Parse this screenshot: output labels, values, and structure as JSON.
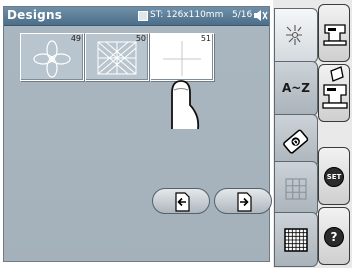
{
  "header": {
    "title": "Designs",
    "stitch_area": "ST: 126x110mm",
    "page_indicator": "5/16"
  },
  "thumbnails": [
    {
      "number": "49",
      "design": "four-petal flower outline"
    },
    {
      "number": "50",
      "design": "diagonal lattice square"
    },
    {
      "number": "51",
      "design": "cross grid",
      "selected": true
    }
  ],
  "navigation": {
    "prev_icon": "page-back-arrow-icon",
    "next_icon": "page-forward-arrow-icon"
  },
  "category_tabs": [
    {
      "name": "tab-builtin-designs",
      "icon": "sparkle-design-icon",
      "label": ""
    },
    {
      "name": "tab-alphabet",
      "icon": "",
      "label": "A~Z"
    },
    {
      "name": "tab-editing",
      "icon": "edit-pen-icon",
      "label": ""
    },
    {
      "name": "tab-grid",
      "icon": "grid-outline-icon",
      "label": ""
    },
    {
      "name": "tab-grid-fine",
      "icon": "fine-grid-icon",
      "label": ""
    }
  ],
  "side_buttons": [
    {
      "name": "sewing-mode-button",
      "icon": "sewing-machine-icon",
      "label": ""
    },
    {
      "name": "embroidery-mode-button",
      "icon": "embroidery-machine-icon",
      "label": ""
    },
    {
      "name": "settings-button",
      "icon": "set-icon",
      "label": "SET"
    },
    {
      "name": "help-button",
      "icon": "question-icon",
      "label": "?"
    }
  ],
  "colors": {
    "panel": "#a8b5bf",
    "titlebar": "#5a7b95",
    "thumbnail": "#b9c5ce",
    "tab_active": "#eef1f3"
  }
}
